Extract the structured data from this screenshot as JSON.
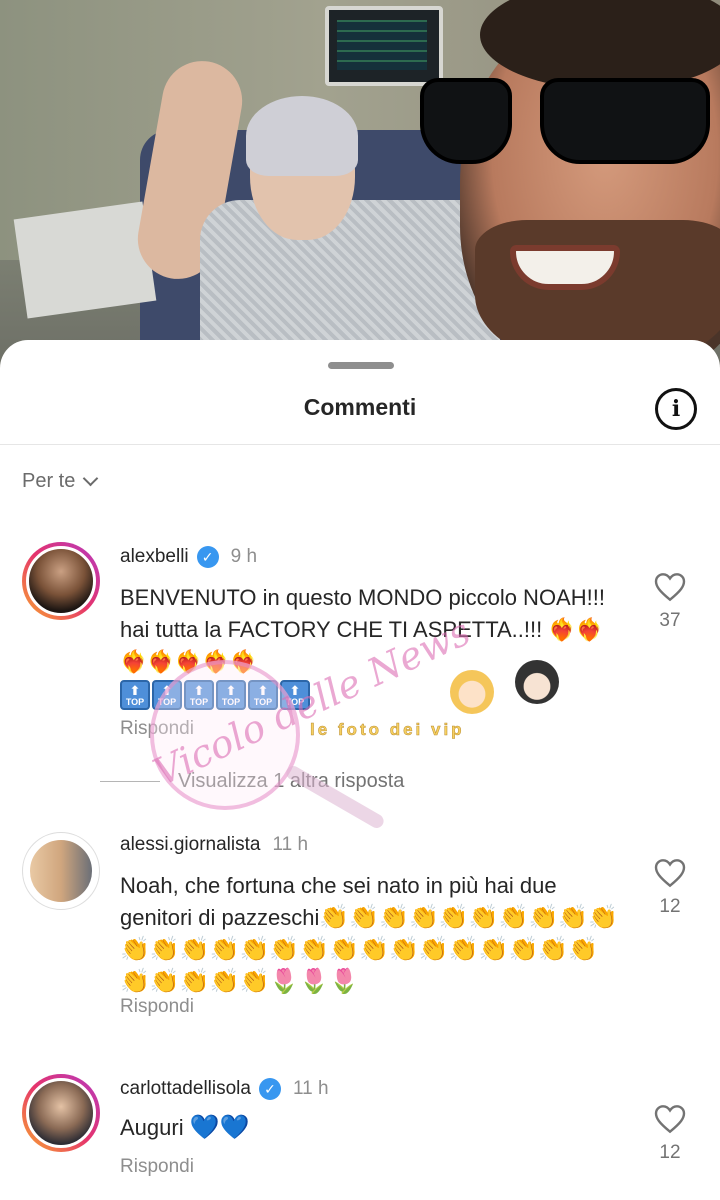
{
  "sheet": {
    "title": "Commenti",
    "filter_label": "Per te"
  },
  "comments": [
    {
      "username": "alexbelli",
      "verified": true,
      "time": "9 h",
      "text": "BENVENUTO in questo MONDO piccolo NOAH!!! hai tutta la FACTORY CHE TI ASPETTA..!!!",
      "emojis": [
        "❤️‍🔥",
        "❤️‍🔥",
        "❤️‍🔥",
        "❤️‍🔥",
        "❤️‍🔥",
        "❤️‍🔥",
        "❤️‍🔥"
      ],
      "badges": [
        "TOP",
        "TOP",
        "TOP",
        "TOP",
        "TOP",
        "TOP"
      ],
      "reply_label": "Rispondi",
      "likes": "37"
    },
    {
      "username": "alessi.giornalista",
      "verified": false,
      "time": "11 h",
      "text": "Noah, che fortuna che sei nato in più hai due genitori di pazzeschi",
      "reply_label": "Rispondi",
      "likes": "12"
    },
    {
      "username": "carlottadellisola",
      "verified": true,
      "time": "11 h",
      "text": "Auguri",
      "reply_label": "Rispondi",
      "likes": "12"
    }
  ],
  "more_replies_label": "Visualizza 1 altra risposta",
  "watermark": {
    "script": "Vicolo delle News",
    "text": "le foto dei vip"
  },
  "colors": {
    "verified": "#3897f0",
    "story_ring": "#e5336c",
    "muted": "#8e8e8e"
  }
}
